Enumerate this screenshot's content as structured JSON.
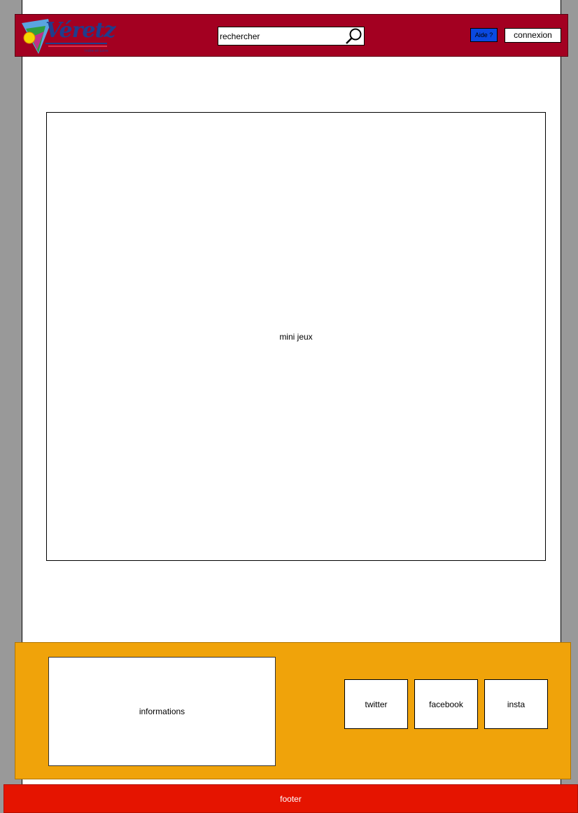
{
  "header": {
    "logo": {
      "text": "Véretz",
      "subtitle": "Indre-et-Loire"
    },
    "search": {
      "value": "rechercher",
      "icon": "search-icon"
    },
    "help_label": "Aide ?",
    "login_label": "connexion"
  },
  "main": {
    "games_label": "mini jeux"
  },
  "info_bar": {
    "informations_label": "informations",
    "social": {
      "twitter": "twitter",
      "facebook": "facebook",
      "insta": "insta"
    }
  },
  "footer": {
    "label": "footer"
  },
  "colors": {
    "page_background": "#999999",
    "header": "#a30021",
    "help_button": "#0a49e0",
    "info_bar": "#f0a30a",
    "footer": "#e51400"
  }
}
